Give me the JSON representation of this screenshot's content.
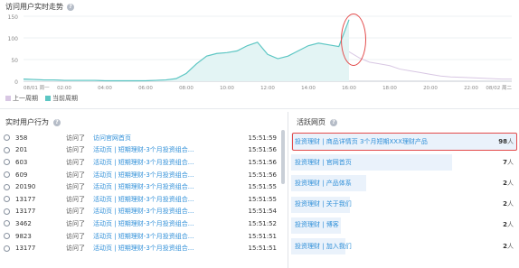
{
  "header": {
    "title": "访问用户实时走势",
    "help": "?"
  },
  "colors": {
    "current": "#5cc6c3",
    "previous": "#d8c7e3",
    "current_fill": "#e3f4f4",
    "link": "#2f8fd8",
    "highlight": "#e34b4b"
  },
  "chart_data": {
    "type": "area",
    "ylim": [
      0,
      150
    ],
    "yticks": [
      "150",
      "100",
      "50",
      "0"
    ],
    "xticks": [
      "08/01 周一",
      "02:00",
      "04:00",
      "06:00",
      "08:00",
      "10:00",
      "12:00",
      "14:00",
      "16:00",
      "18:00",
      "20:00",
      "22:00",
      "08/02 周二"
    ],
    "x_hours": [
      0,
      0.5,
      1,
      1.5,
      2,
      2.5,
      3,
      3.5,
      4,
      4.5,
      5,
      5.5,
      6,
      6.5,
      7,
      7.5,
      8,
      8.5,
      9,
      9.5,
      10,
      10.5,
      11,
      11.5,
      12,
      12.5,
      13,
      13.5,
      14,
      14.5,
      15,
      15.5,
      16,
      16.5,
      17,
      17.5,
      18,
      18.5,
      19,
      19.5,
      20,
      20.5,
      21,
      21.5,
      22,
      22.5,
      23,
      23.5,
      24
    ],
    "series": [
      {
        "name": "上一周期",
        "values": [
          5,
          4,
          3,
          3,
          2,
          2,
          2,
          2,
          1,
          1,
          1,
          1,
          1,
          2,
          3,
          5,
          14,
          32,
          50,
          58,
          60,
          62,
          70,
          78,
          58,
          48,
          54,
          64,
          74,
          80,
          76,
          70,
          68,
          54,
          44,
          40,
          36,
          28,
          24,
          20,
          16,
          12,
          10,
          9,
          8,
          7,
          6,
          5,
          5
        ]
      },
      {
        "name": "当前周期",
        "values": [
          5,
          4,
          3,
          3,
          2,
          2,
          2,
          2,
          1,
          1,
          1,
          1,
          1,
          2,
          3,
          6,
          18,
          40,
          58,
          64,
          66,
          70,
          82,
          90,
          62,
          52,
          58,
          70,
          82,
          88,
          84,
          80,
          142
        ]
      }
    ],
    "legend": [
      "上一周期",
      "当前周期"
    ]
  },
  "behavior": {
    "title": "实时用户行为",
    "help": "?",
    "rows": [
      {
        "id": "358",
        "action": "访问了",
        "page": "访问官网首页",
        "time": "15:51:59"
      },
      {
        "id": "201",
        "action": "访问了",
        "page": "活动页 | 短期理财-3个月投资组合...",
        "time": "15:51:56"
      },
      {
        "id": "603",
        "action": "访问了",
        "page": "活动页 | 短期理财-3个月投资组合...",
        "time": "15:51:56"
      },
      {
        "id": "609",
        "action": "访问了",
        "page": "活动页 | 短期理财-3个月投资组合...",
        "time": "15:51:56"
      },
      {
        "id": "20190",
        "action": "访问了",
        "page": "活动页 | 短期理财-3个月投资组合...",
        "time": "15:51:55"
      },
      {
        "id": "13177",
        "action": "访问了",
        "page": "活动页 | 短期理财-3个月投资组合...",
        "time": "15:51:55"
      },
      {
        "id": "13177",
        "action": "访问了",
        "page": "活动页 | 短期理财-3个月投资组合...",
        "time": "15:51:54"
      },
      {
        "id": "3462",
        "action": "访问了",
        "page": "活动页 | 短期理财-3个月投资组合...",
        "time": "15:51:52"
      },
      {
        "id": "9823",
        "action": "访问了",
        "page": "活动页 | 短期理财-3个月投资组合...",
        "time": "15:51:51"
      },
      {
        "id": "13177",
        "action": "访问了",
        "page": "活动页 | 短期理财-3个月投资组合...",
        "time": "15:51:51"
      }
    ]
  },
  "pages": {
    "title": "活跃网页",
    "help": "?",
    "unit": "人",
    "rows": [
      {
        "name": "投资理财 | 商品详情页 3个月短期XXX理财产品",
        "count": "98",
        "share": 1.0
      },
      {
        "name": "投资理财 | 官网首页",
        "count": "7",
        "share": 0.71
      },
      {
        "name": "投资理财 | 产品体系",
        "count": "2",
        "share": 0.33
      },
      {
        "name": "投资理财 | 关于我们",
        "count": "2",
        "share": 0.26
      },
      {
        "name": "投资理财 | 博客",
        "count": "2",
        "share": 0.22
      },
      {
        "name": "投资理财 | 加入我们",
        "count": "2",
        "share": 0.24
      }
    ]
  }
}
